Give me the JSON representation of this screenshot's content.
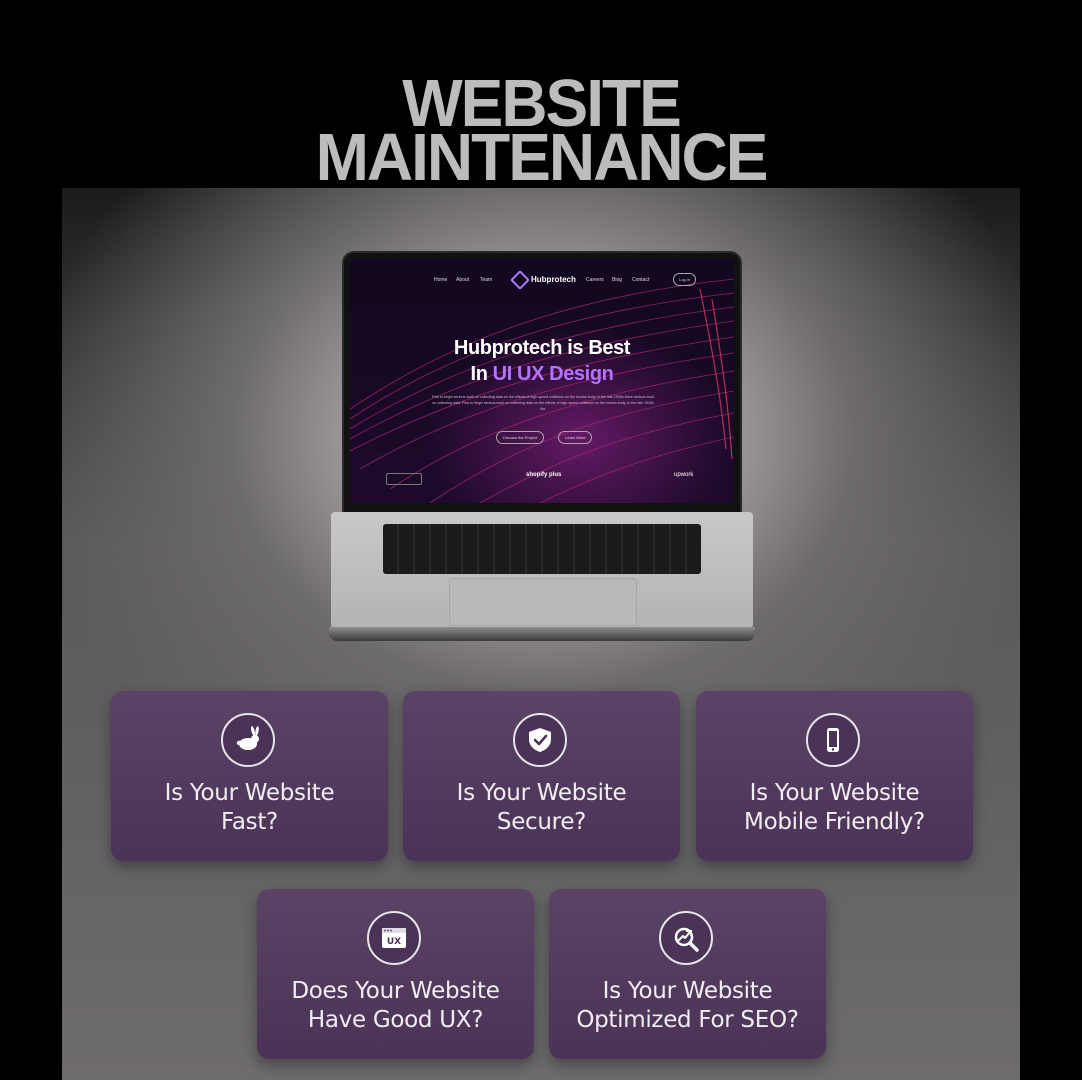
{
  "title": {
    "line1": "WEBSITE",
    "line2": "MAINTENANCE"
  },
  "laptop": {
    "nav": [
      "Home",
      "About",
      "Team",
      "Careers",
      "Blog",
      "Contact"
    ],
    "brand": "Hubprotech",
    "login": "Log in",
    "hero_line1": "Hubprotech is Best",
    "hero_line2_prefix": "In ",
    "hero_line2_accent": "UI UX Design",
    "description": "First to begin serious work on collecting data on the effects of high-speed collisions on the human body, in the late 1930s there serious work on collecting data. First to begin serious work on collecting data on the effects of high-speed collisions on the human body. In the late 1930s the",
    "button1": "Discuss the Project",
    "button2": "Learn More",
    "partner1": "shopify plus",
    "partner2": "upwork"
  },
  "cards": [
    {
      "icon": "rabbit-icon",
      "line1": "Is Your Website",
      "line2": "Fast?"
    },
    {
      "icon": "shield-check-icon",
      "line1": "Is Your Website",
      "line2": "Secure?"
    },
    {
      "icon": "smartphone-icon",
      "line1": "Is Your Website",
      "line2": "Mobile Friendly?"
    },
    {
      "icon": "ux-browser-icon",
      "line1": "Does Your Website",
      "line2": "Have Good UX?"
    },
    {
      "icon": "seo-chart-magnifier-icon",
      "line1": "Is Your Website",
      "line2": "Optimized For SEO?"
    }
  ],
  "colors": {
    "card": "#4f3a5b",
    "accent": "#b473ff",
    "title": "#bdbbbd"
  }
}
